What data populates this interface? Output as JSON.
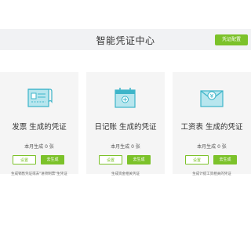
{
  "header": {
    "title": "智能凭证中心",
    "settings_button": "凭证配置"
  },
  "cards": [
    {
      "icon": "invoice-icon",
      "title": "发票 生成的凭证",
      "count": "本月生成 0 张",
      "settings_label": "设置",
      "generate_label": "去生成",
      "note": "生成销售凭证或去\"进项制票\"生凭证"
    },
    {
      "icon": "journal-calendar-icon",
      "title": "日记账 生成的凭证",
      "count": "本月生成 0 张",
      "settings_label": "设置",
      "generate_label": "去生成",
      "note": "生成资金相关凭证"
    },
    {
      "icon": "salary-envelope-icon",
      "title": "工资表 生成的凭证",
      "count": "本月生成 0 张",
      "settings_label": "设置",
      "generate_label": "去生成",
      "note": "生成计提工资相关的凭证"
    }
  ],
  "colors": {
    "accent": "#7cc22a",
    "icon_teal": "#3db5c9",
    "icon_fill": "#b8e6ee",
    "card_bg": "#f5f5f5",
    "header_bg": "#f1f2f4"
  }
}
